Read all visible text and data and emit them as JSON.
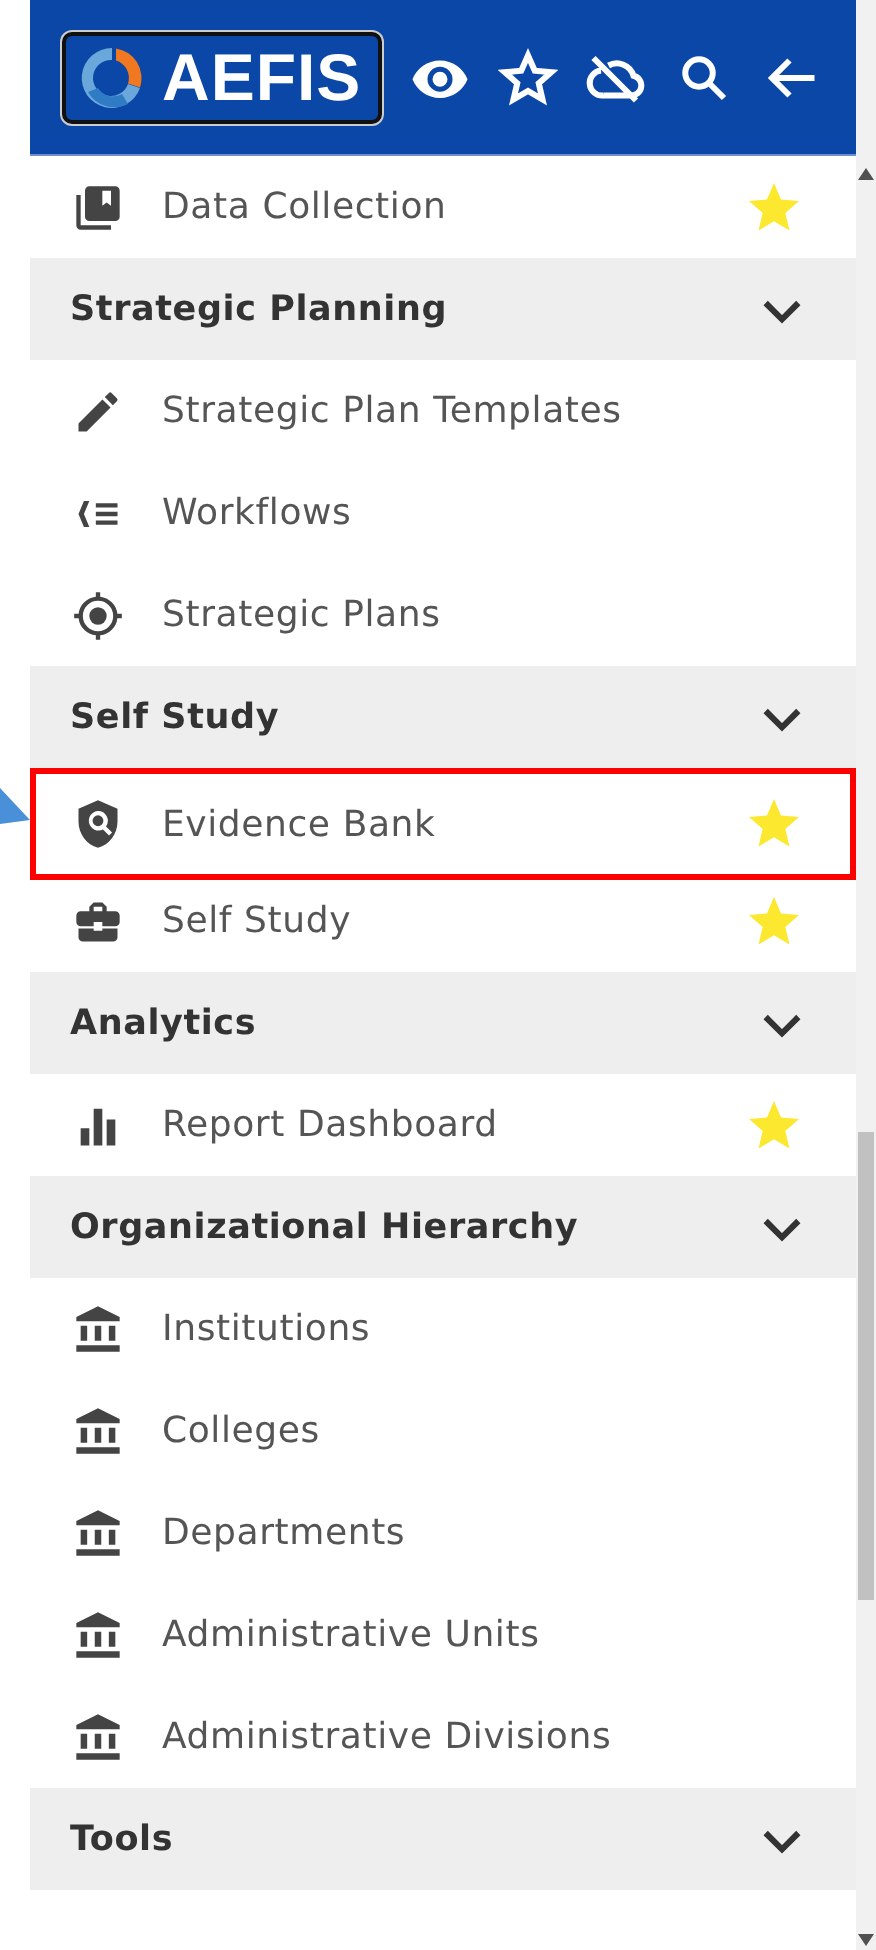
{
  "header": {
    "logo": "AEFIS"
  },
  "top_items": [
    {
      "kind": "collection",
      "label": "Data Collection",
      "starred": true,
      "highlighted": false
    }
  ],
  "sections": [
    {
      "title": "Strategic Planning",
      "expanded": true,
      "items": [
        {
          "kind": "edit",
          "label": "Strategic Plan Templates",
          "starred": false,
          "highlighted": false
        },
        {
          "kind": "workflow",
          "label": "Workflows",
          "starred": false,
          "highlighted": false
        },
        {
          "kind": "target",
          "label": "Strategic Plans",
          "starred": false,
          "highlighted": false
        }
      ]
    },
    {
      "title": "Self Study",
      "expanded": true,
      "items": [
        {
          "kind": "shield",
          "label": "Evidence Bank",
          "starred": true,
          "highlighted": true
        },
        {
          "kind": "briefcase",
          "label": "Self Study",
          "starred": true,
          "highlighted": false
        }
      ]
    },
    {
      "title": "Analytics",
      "expanded": true,
      "items": [
        {
          "kind": "chart",
          "label": "Report Dashboard",
          "starred": true,
          "highlighted": false
        }
      ]
    },
    {
      "title": "Organizational Hierarchy",
      "expanded": true,
      "items": [
        {
          "kind": "building",
          "label": "Institutions",
          "starred": false,
          "highlighted": false
        },
        {
          "kind": "building",
          "label": "Colleges",
          "starred": false,
          "highlighted": false
        },
        {
          "kind": "building",
          "label": "Departments",
          "starred": false,
          "highlighted": false
        },
        {
          "kind": "building",
          "label": "Administrative Units",
          "starred": false,
          "highlighted": false
        },
        {
          "kind": "building",
          "label": "Administrative Divisions",
          "starred": false,
          "highlighted": false
        }
      ]
    },
    {
      "title": "Tools",
      "expanded": true
    }
  ]
}
